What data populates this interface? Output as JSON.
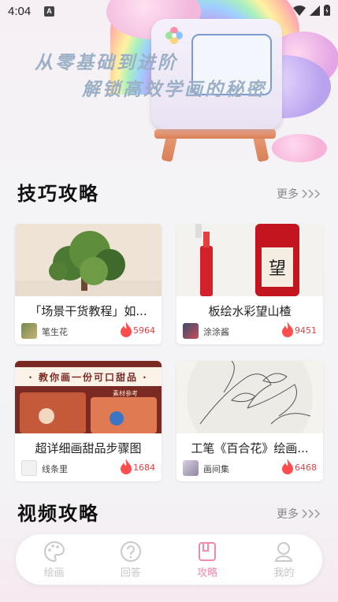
{
  "status": {
    "time": "4:04",
    "badge": "A"
  },
  "banner": {
    "line1": "从零基础到进阶",
    "line2": "解锁高效学画的秘密"
  },
  "skills": {
    "title": "技巧攻略",
    "more": "更多",
    "cards": [
      {
        "title": "「场景干货教程」如...",
        "author": "笔生花",
        "count": "5964"
      },
      {
        "title": "板绘水彩望山楂",
        "author": "涂涂酱",
        "count": "9451"
      },
      {
        "title": "超详细画甜品步骤图",
        "author": "线条里",
        "count": "1684",
        "image_text": "· 教你画一份可口甜品 ·",
        "image_sub": "素材参考"
      },
      {
        "title": "工笔《百合花》绘画...",
        "author": "画间集",
        "count": "6468"
      }
    ]
  },
  "videos": {
    "title": "视频攻略",
    "more": "更多"
  },
  "nav": {
    "items": [
      {
        "label": "绘画",
        "icon": "palette-icon"
      },
      {
        "label": "回答",
        "icon": "question-icon"
      },
      {
        "label": "攻略",
        "icon": "book-icon",
        "active": true
      },
      {
        "label": "我的",
        "icon": "user-icon"
      }
    ],
    "active_color": "#f08aa9",
    "inactive_color": "#c6c6c6"
  },
  "colors": {
    "accent": "#e04343",
    "heat": "#ff4d4d"
  }
}
